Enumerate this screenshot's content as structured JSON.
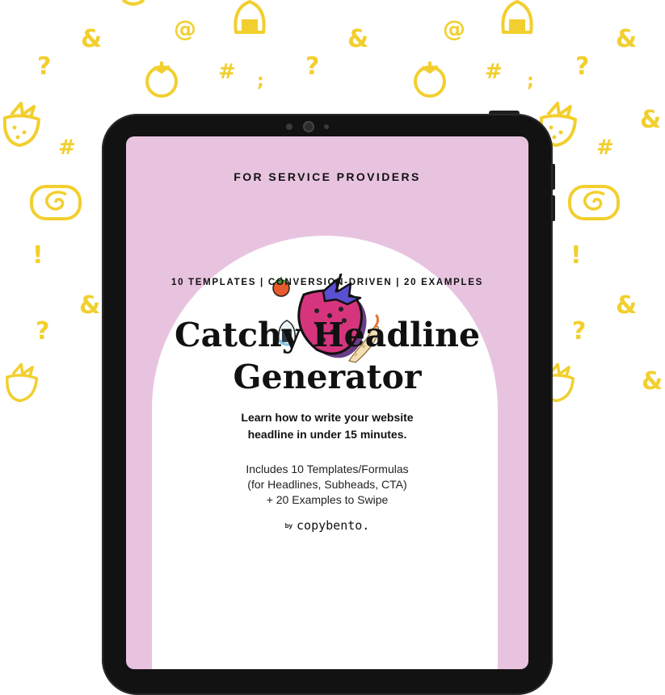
{
  "cover": {
    "audience_label": "FOR SERVICE PROVIDERS",
    "tagline": "10 TEMPLATES | CONVERSION-DRIVEN | 20 EXAMPLES",
    "title_line1": "Catchy Headline",
    "title_line2": "Generator",
    "lead_line1": "Learn how to write your website",
    "lead_line2": "headline in under 15 minutes.",
    "includes_line1": "Includes 10 Templates/Formulas",
    "includes_line2": "(for Headlines, Subheads, CTA)",
    "includes_line3": "+ 20 Examples to Swipe",
    "by_label": "by",
    "brand_name": "copybento."
  },
  "background_symbols": {
    "ampersand": "&",
    "question": "?",
    "at": "@",
    "hash": "#",
    "semicolon": ";",
    "exclamation": "!"
  },
  "colors": {
    "doodle_yellow": "#f2cf2e",
    "screen_pink": "#e8c3e0",
    "tablet_frame": "#121212",
    "strawberry_pink": "#d6357e"
  },
  "icons": [
    "strawberry-icon",
    "tomato-icon",
    "onigiri-icon",
    "shrimp-tempura-icon",
    "swirl-roll-icon"
  ]
}
